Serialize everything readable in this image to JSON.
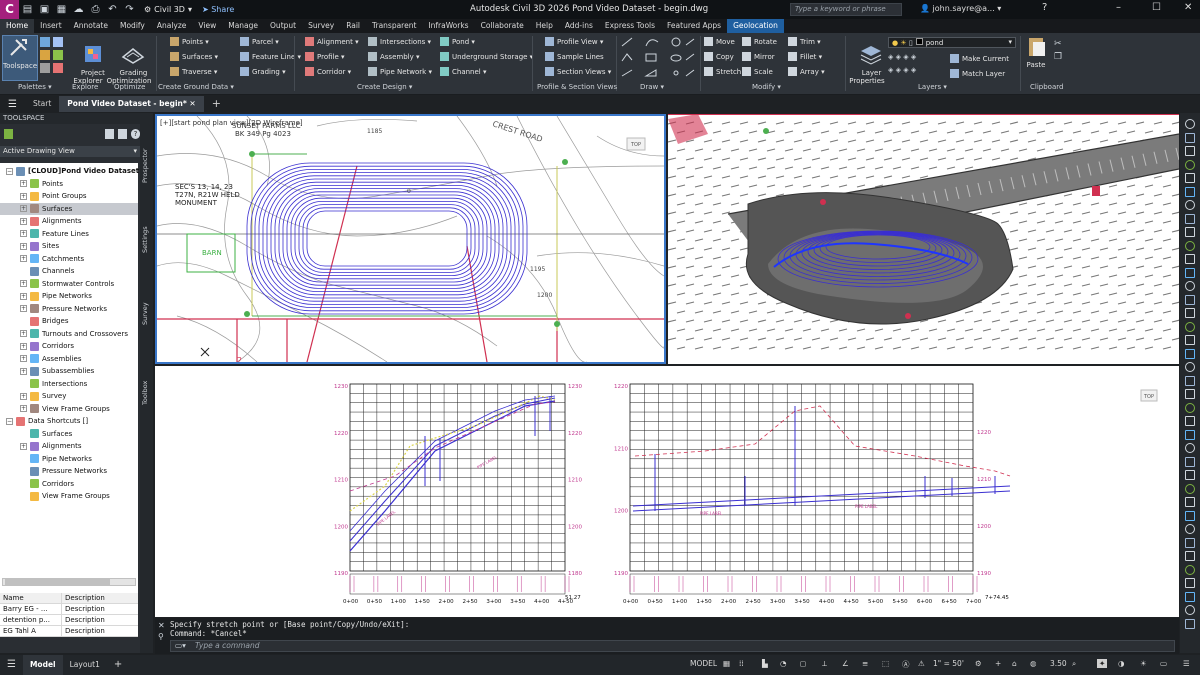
{
  "app": {
    "workspace": "Civil 3D",
    "share": "Share",
    "window_title": "Autodesk Civil 3D 2026   Pond Video Dataset - begin.dwg",
    "search_placeholder": "Type a keyword or phrase",
    "user": "john.sayre@a..."
  },
  "menu_tabs": [
    "Home",
    "Insert",
    "Annotate",
    "Modify",
    "Analyze",
    "View",
    "Manage",
    "Output",
    "Survey",
    "Rail",
    "Transparent",
    "InfraWorks",
    "Collaborate",
    "Help",
    "Add-ins",
    "Express Tools",
    "Featured Apps",
    "Geolocation"
  ],
  "ribbon": {
    "big": [
      {
        "label": "Toolspace",
        "icon": "toolspace-icon"
      },
      {
        "label": "Project\nExplorer",
        "icon": "project-explorer-icon"
      },
      {
        "label": "Grading\nOptimization",
        "icon": "grading-optimization-icon"
      }
    ],
    "col1": [
      "Points ▾",
      "Surfaces ▾",
      "Traverse ▾"
    ],
    "col2": [
      "Parcel ▾",
      "Feature Line ▾",
      "Grading ▾"
    ],
    "col3": [
      "Alignment ▾",
      "Profile ▾",
      "Corridor ▾"
    ],
    "col4": [
      "Intersections ▾",
      "Assembly ▾",
      "Pipe Network ▾"
    ],
    "col5": [
      "Pond ▾",
      "Underground Storage ▾",
      "Channel ▾"
    ],
    "col6": [
      "Profile View ▾",
      "Sample Lines",
      "Section Views ▾"
    ],
    "modify1": [
      "Move",
      "Copy",
      "Stretch"
    ],
    "modify2": [
      "Rotate",
      "Mirror",
      "Scale"
    ],
    "modify3": [
      "Trim ▾",
      "Fillet ▾",
      "Array ▾"
    ],
    "layer_name": "pond",
    "layer_btns": [
      "Make Current",
      "Match Layer"
    ],
    "layer_props": "Layer\nProperties",
    "paste": "Paste",
    "panels": [
      "Palettes ▾",
      "Explore",
      "Optimize",
      "Create Ground Data ▾",
      "Create Design ▾",
      "Profile & Section Views",
      "Draw ▾",
      "Modify ▾",
      "Layers ▾",
      "Clipboard"
    ]
  },
  "file_tabs": {
    "start": "Start",
    "active": "Pond Video Dataset - begin*"
  },
  "toolspace": {
    "title": "TOOLSPACE",
    "view": "Active Drawing View",
    "tree": [
      {
        "label": "[CLOUD]Pond Video Dataset ...",
        "level": 0,
        "exp": "−",
        "bold": true
      },
      {
        "label": "Points",
        "level": 1,
        "exp": "+"
      },
      {
        "label": "Point Groups",
        "level": 1,
        "exp": "+"
      },
      {
        "label": "Surfaces",
        "level": 1,
        "exp": "+",
        "sel": true
      },
      {
        "label": "Alignments",
        "level": 1,
        "exp": "+"
      },
      {
        "label": "Feature Lines",
        "level": 1,
        "exp": "+"
      },
      {
        "label": "Sites",
        "level": 1,
        "exp": "+"
      },
      {
        "label": "Catchments",
        "level": 1,
        "exp": "+"
      },
      {
        "label": "Channels",
        "level": 1,
        "exp": ""
      },
      {
        "label": "Stormwater Controls",
        "level": 1,
        "exp": "+"
      },
      {
        "label": "Pipe Networks",
        "level": 1,
        "exp": "+"
      },
      {
        "label": "Pressure Networks",
        "level": 1,
        "exp": "+"
      },
      {
        "label": "Bridges",
        "level": 1,
        "exp": ""
      },
      {
        "label": "Turnouts and Crossovers",
        "level": 1,
        "exp": "+"
      },
      {
        "label": "Corridors",
        "level": 1,
        "exp": "+"
      },
      {
        "label": "Assemblies",
        "level": 1,
        "exp": "+"
      },
      {
        "label": "Subassemblies",
        "level": 1,
        "exp": "+"
      },
      {
        "label": "Intersections",
        "level": 1,
        "exp": ""
      },
      {
        "label": "Survey",
        "level": 1,
        "exp": "+"
      },
      {
        "label": "View Frame Groups",
        "level": 1,
        "exp": "+"
      },
      {
        "label": "Data Shortcuts []",
        "level": 0,
        "exp": "−"
      },
      {
        "label": "Surfaces",
        "level": 1,
        "exp": ""
      },
      {
        "label": "Alignments",
        "level": 1,
        "exp": "+"
      },
      {
        "label": "Pipe Networks",
        "level": 1,
        "exp": ""
      },
      {
        "label": "Pressure Networks",
        "level": 1,
        "exp": ""
      },
      {
        "label": "Corridors",
        "level": 1,
        "exp": ""
      },
      {
        "label": "View Frame Groups",
        "level": 1,
        "exp": ""
      }
    ],
    "table_headers": [
      "Name",
      "Description"
    ],
    "table_rows": [
      [
        "Barry EG - ...",
        "Description"
      ],
      [
        "detention p...",
        "Description"
      ],
      [
        "EG Tahl A",
        "Description"
      ]
    ]
  },
  "side_tabs": [
    "Prospector",
    "Settings",
    "Survey",
    "Toolbox"
  ],
  "plan_view": {
    "viewport_label": "[+][start pond plan view][2D Wireframe]",
    "owner": "SUNSET FARMS LLC",
    "bk": "BK 349 Pg 4023",
    "sec1": "SEC'S 13, 14, 23",
    "sec2": "T27N, R21W  HELD",
    "sec3": "MONUMENT",
    "barn": "BARN",
    "road": "CREST ROAD",
    "contours": [
      "1185",
      "1195",
      "1200",
      "0"
    ],
    "corner": "2"
  },
  "profile_views": {
    "left_y": [
      "1230",
      "1220",
      "1210",
      "1200",
      "1190"
    ],
    "left_yr": [
      "1230",
      "1220",
      "1210",
      "1200",
      "1180"
    ],
    "left_x": [
      "0+00",
      "0+50",
      "1+00",
      "1+50",
      "2+00",
      "2+50",
      "3+00",
      "3+50",
      "4+00",
      "4+50"
    ],
    "left_end": "51.27",
    "right_y": [
      "1220",
      "1210",
      "1200",
      "1190"
    ],
    "right_x": [
      "0+00",
      "0+50",
      "1+00",
      "1+50",
      "2+00",
      "2+50",
      "3+00",
      "3+50",
      "4+00",
      "4+50",
      "5+00",
      "5+50",
      "6+00",
      "6+50",
      "7+00"
    ],
    "right_end": "7+74.45"
  },
  "command": {
    "line1": "Specify stretch point or [Base point/Copy/Undo/eXit]:",
    "line2": "Command: *Cancel*",
    "placeholder": "Type a command"
  },
  "status": {
    "tabs": [
      "Model",
      "Layout1"
    ],
    "model": "MODEL",
    "scale": "1\" = 50'",
    "value": "3.50"
  }
}
